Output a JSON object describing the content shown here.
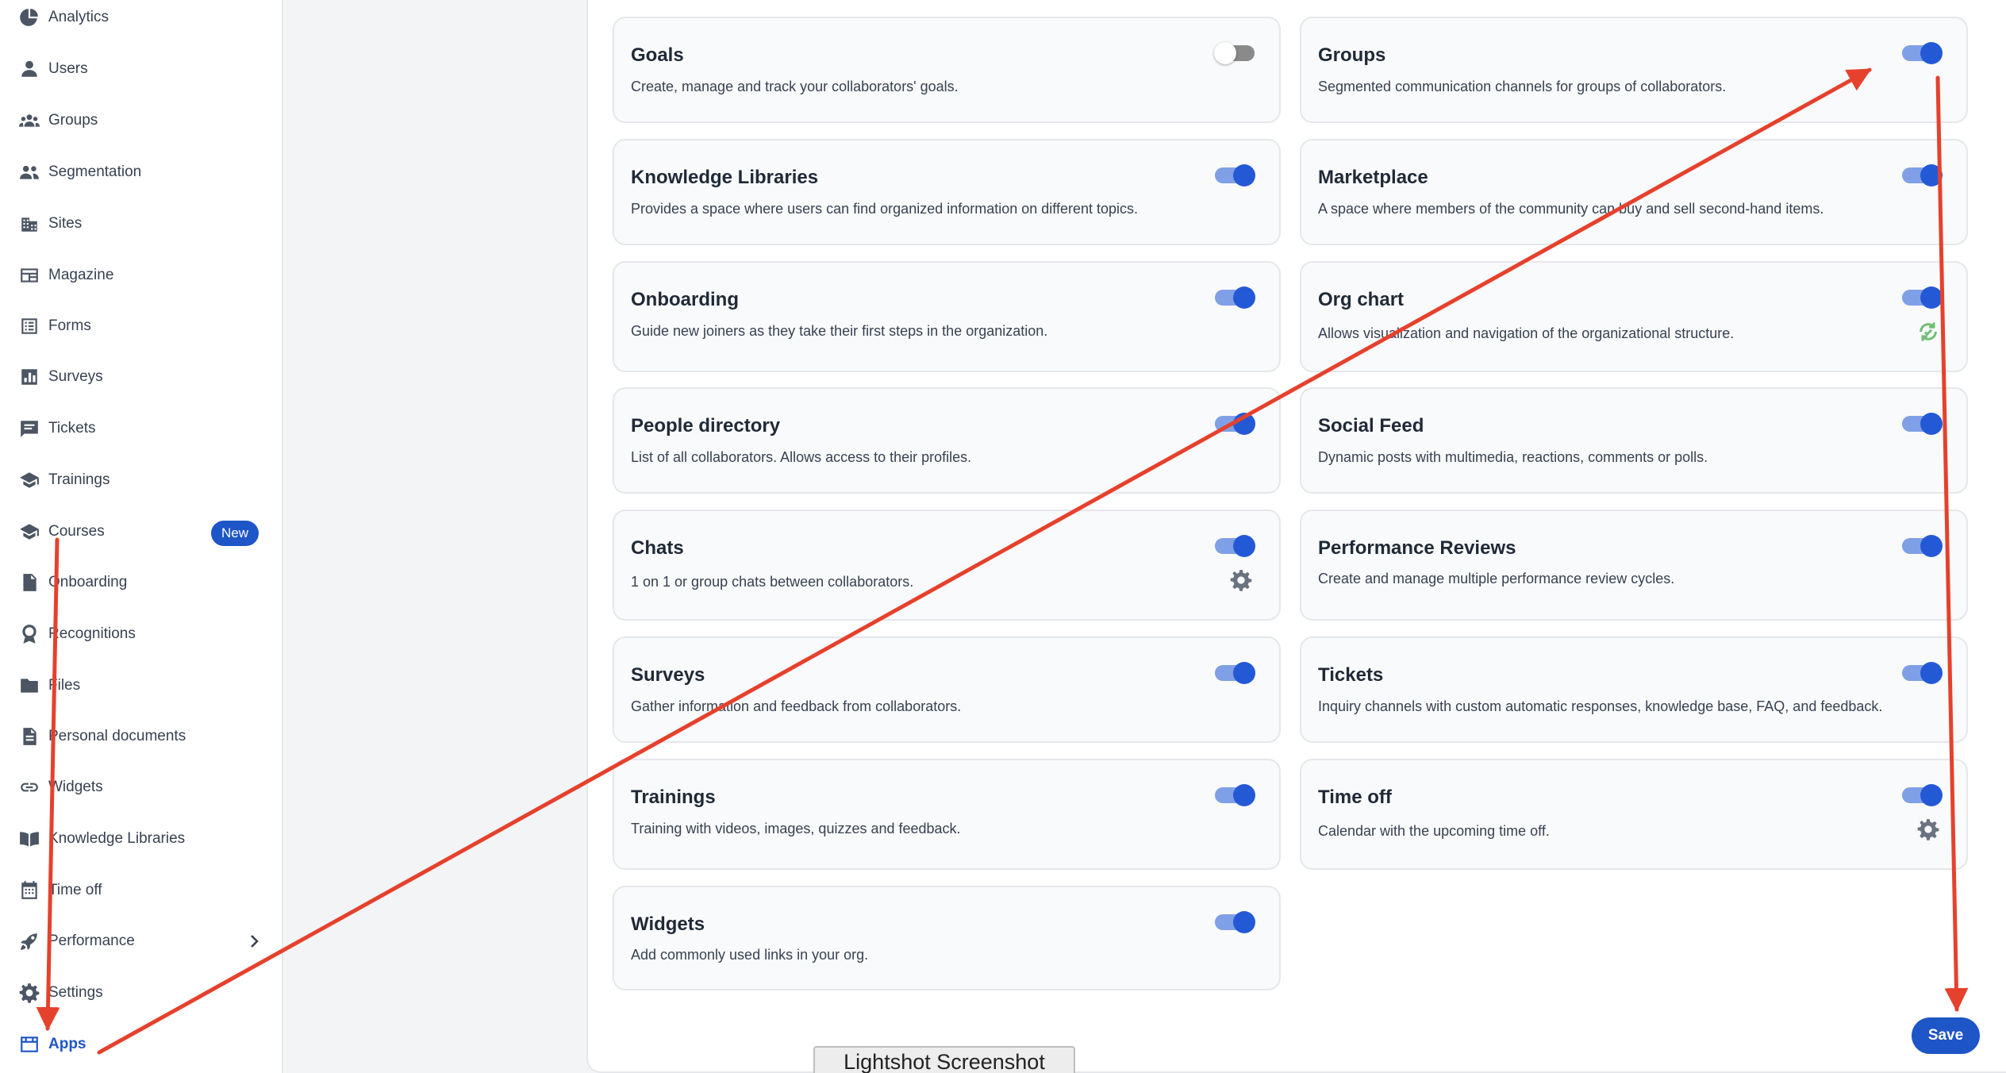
{
  "sidebar": {
    "items": [
      {
        "label": "Analytics",
        "icon": "chart-pie-icon"
      },
      {
        "label": "Users",
        "icon": "user-icon"
      },
      {
        "label": "Groups",
        "icon": "groups-icon"
      },
      {
        "label": "Segmentation",
        "icon": "people-icon"
      },
      {
        "label": "Sites",
        "icon": "building-icon"
      },
      {
        "label": "Magazine",
        "icon": "newspaper-icon"
      },
      {
        "label": "Forms",
        "icon": "form-icon"
      },
      {
        "label": "Surveys",
        "icon": "bar-chart-icon"
      },
      {
        "label": "Tickets",
        "icon": "ticket-message-icon"
      },
      {
        "label": "Trainings",
        "icon": "graduation-cap-icon"
      },
      {
        "label": "Courses",
        "icon": "graduation-cap-icon",
        "badge": "New"
      },
      {
        "label": "Onboarding",
        "icon": "onboarding-doc-icon"
      },
      {
        "label": "Recognitions",
        "icon": "award-icon"
      },
      {
        "label": "Files",
        "icon": "folder-icon"
      },
      {
        "label": "Personal documents",
        "icon": "document-icon"
      },
      {
        "label": "Widgets",
        "icon": "link-icon"
      },
      {
        "label": "Knowledge Libraries",
        "icon": "book-icon"
      },
      {
        "label": "Time off",
        "icon": "calendar-icon"
      },
      {
        "label": "Performance",
        "icon": "rocket-icon",
        "has_submenu": true
      },
      {
        "label": "Settings",
        "icon": "gear-icon"
      },
      {
        "label": "Apps",
        "icon": "apps-grid-icon",
        "active": true
      }
    ]
  },
  "apps": [
    {
      "title": "Goals",
      "description": "Create, manage and track your collaborators' goals.",
      "enabled": false
    },
    {
      "title": "Groups",
      "description": "Segmented communication channels for groups of collaborators.",
      "enabled": true
    },
    {
      "title": "Knowledge Libraries",
      "description": "Provides a space where users can find organized information on different topics.",
      "enabled": true
    },
    {
      "title": "Marketplace",
      "description": "A space where members of the community can buy and sell second-hand items.",
      "enabled": true
    },
    {
      "title": "Onboarding",
      "description": "Guide new joiners as they take their first steps in the organization.",
      "enabled": true
    },
    {
      "title": "Org chart",
      "description": "Allows visualization and navigation of the organizational structure.",
      "enabled": true,
      "extra_icon": "sync-icon"
    },
    {
      "title": "People directory",
      "description": "List of all collaborators. Allows access to their profiles.",
      "enabled": true
    },
    {
      "title": "Social Feed",
      "description": "Dynamic posts with multimedia, reactions, comments or polls.",
      "enabled": true
    },
    {
      "title": "Chats",
      "description": "1 on 1 or group chats between collaborators.",
      "enabled": true,
      "extra_icon": "gear-icon"
    },
    {
      "title": "Performance Reviews",
      "description": "Create and manage multiple performance review cycles.",
      "enabled": true
    },
    {
      "title": "Surveys",
      "description": "Gather information and feedback from collaborators.",
      "enabled": true
    },
    {
      "title": "Tickets",
      "description": "Inquiry channels with custom automatic responses, knowledge base, FAQ, and feedback.",
      "enabled": true
    },
    {
      "title": "Trainings",
      "description": "Training with videos, images, quizzes and feedback.",
      "enabled": true
    },
    {
      "title": "Time off",
      "description": "Calendar with the upcoming time off.",
      "enabled": true,
      "extra_icon": "gear-icon"
    },
    {
      "title": "Widgets",
      "description": "Add commonly used links in your org.",
      "enabled": true
    }
  ],
  "footer": {
    "save_label": "Save"
  },
  "overlay": {
    "lightshot_label": "Lightshot Screenshot"
  },
  "colors": {
    "accent": "#1e55c7",
    "toggle_on": "#2459d6",
    "annotation": "#e5412d"
  }
}
